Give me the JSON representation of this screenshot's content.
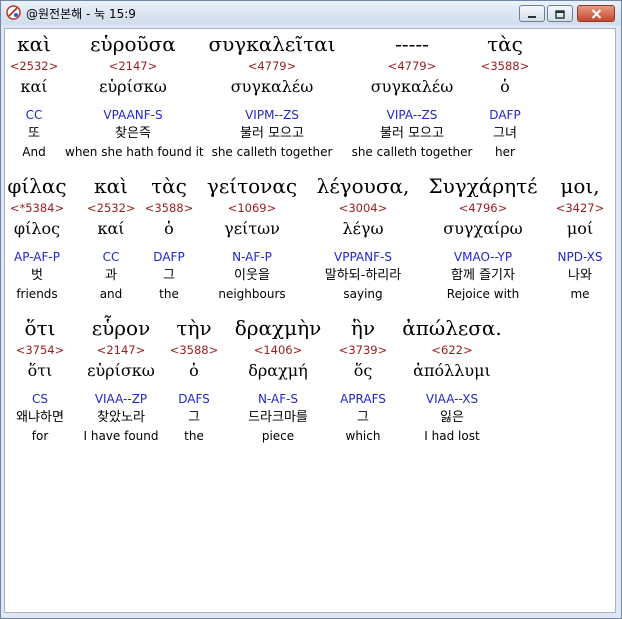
{
  "window": {
    "title": "@원전본해 - 눅 15:9"
  },
  "rows": [
    {
      "words": [
        {
          "greek": "καὶ",
          "strong": "<2532>",
          "lemma": "καί",
          "parse": "CC",
          "korean": "또",
          "english": "And"
        },
        {
          "greek": "εὑροῦσα",
          "strong": "<2147>",
          "lemma": "εὑρίσκω",
          "parse": "VPAANF-S",
          "korean": "찾은즉",
          "english": "when she hath found it"
        },
        {
          "greek": "συγκαλεῖται",
          "strong": "<4779>",
          "lemma": "συγκαλέω",
          "parse": "VIPM--ZS",
          "korean": "불러 모으고",
          "english": "she calleth together"
        },
        {
          "greek": "-----",
          "strong": "<4779>",
          "lemma": "συγκαλέω",
          "parse": "VIPA--ZS",
          "korean": "불러 모으고",
          "english": "she calleth together"
        },
        {
          "greek": "τὰς",
          "strong": "<3588>",
          "lemma": "ὁ",
          "parse": "DAFP",
          "korean": "그녀",
          "english": "her"
        }
      ]
    },
    {
      "words": [
        {
          "greek": "φίλας",
          "strong": "<*5384>",
          "lemma": "φίλος",
          "parse": "AP-AF-P",
          "korean": "벗",
          "english": "friends"
        },
        {
          "greek": "καὶ",
          "strong": "<2532>",
          "lemma": "καί",
          "parse": "CC",
          "korean": "과",
          "english": "and"
        },
        {
          "greek": "τὰς",
          "strong": "<3588>",
          "lemma": "ὁ",
          "parse": "DAFP",
          "korean": "그",
          "english": "the"
        },
        {
          "greek": "γείτονας",
          "strong": "<1069>",
          "lemma": "γείτων",
          "parse": "N-AF-P",
          "korean": "이웃을",
          "english": "neighbours"
        },
        {
          "greek": "λέγουσα,",
          "strong": "<3004>",
          "lemma": "λέγω",
          "parse": "VPPANF-S",
          "korean": "말하되-하리라",
          "english": "saying"
        },
        {
          "greek": "Συγχάρητέ",
          "strong": "<4796>",
          "lemma": "συγχαίρω",
          "parse": "VMAO--YP",
          "korean": "함께 즐기자",
          "english": "Rejoice with"
        },
        {
          "greek": "μοι,",
          "strong": "<3427>",
          "lemma": "μοί",
          "parse": "NPD-XS",
          "korean": "나와",
          "english": "me"
        }
      ]
    },
    {
      "words": [
        {
          "greek": "ὅτι",
          "strong": "<3754>",
          "lemma": "ὅτι",
          "parse": "CS",
          "korean": "왜냐하면",
          "english": "for"
        },
        {
          "greek": "εὗρον",
          "strong": "<2147>",
          "lemma": "εὑρίσκω",
          "parse": "VIAA--ZP",
          "korean": "찾았노라",
          "english": "I have found"
        },
        {
          "greek": "τὴν",
          "strong": "<3588>",
          "lemma": "ὁ",
          "parse": "DAFS",
          "korean": "그",
          "english": "the"
        },
        {
          "greek": "δραχμὴν",
          "strong": "<1406>",
          "lemma": "δραχμή",
          "parse": "N-AF-S",
          "korean": "드라크마를",
          "english": "piece"
        },
        {
          "greek": "ἣν",
          "strong": "<3739>",
          "lemma": "ὅς",
          "parse": "APRAFS",
          "korean": "그",
          "english": "which"
        },
        {
          "greek": "ἀπώλεσα.",
          "strong": "<622>",
          "lemma": "ἀπόλλυμι",
          "parse": "VIAA--XS",
          "korean": "잃은",
          "english": "I had lost"
        }
      ]
    }
  ]
}
